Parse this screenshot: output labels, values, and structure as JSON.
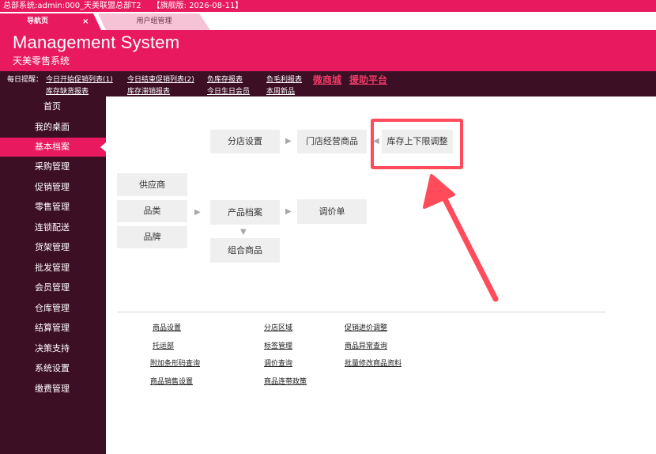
{
  "topbar": {
    "system_text": "总部系统:admin:000_天美联盟总部T2",
    "version_text": "【旗舰版: 2026-08-11】"
  },
  "tabs": [
    {
      "label": "导航页",
      "close": "×"
    },
    {
      "label": "用户组管理"
    }
  ],
  "header": {
    "title": "Management System",
    "subtitle": "天美零售系统"
  },
  "reminder": {
    "label": "每日提醒：",
    "links": [
      "今日开始促销列表(1)",
      "今日结束促销列表(2)",
      "负库存报表",
      "负毛利报表",
      "库存缺货报表",
      "库存滞销报表",
      "今日生日会员",
      "本周新品"
    ],
    "big_links": [
      "微商城",
      "援助平台"
    ]
  },
  "sidebar": {
    "items": [
      "首页",
      "我的桌面",
      "基本档案",
      "采购管理",
      "促销管理",
      "零售管理",
      "连锁配送",
      "货架管理",
      "批发管理",
      "会员管理",
      "仓库管理",
      "结算管理",
      "决策支持",
      "系统设置",
      "缴费管理"
    ],
    "active_index": 2
  },
  "flow": {
    "store_settings": "分店设置",
    "store_products": "门店经营商品",
    "stock_limits": "库存上下限调整",
    "supplier": "供应商",
    "category": "品类",
    "brand": "品牌",
    "product_archive": "产品档案",
    "price_adjust": "调价单",
    "combo_products": "组合商品"
  },
  "links": {
    "col1": [
      "商品设置",
      "托运部",
      "附加条形码查询",
      "商品销售设置"
    ],
    "col2": [
      "分店区域",
      "标签管理",
      "调价查询",
      "商品连带政策"
    ],
    "col3": [
      "促销进价调整",
      "商品异常查询",
      "批量修改商品资料"
    ]
  },
  "colors": {
    "brand": "#e8195e",
    "sidebar": "#3d0f25",
    "highlight": "#ff4b5a"
  }
}
